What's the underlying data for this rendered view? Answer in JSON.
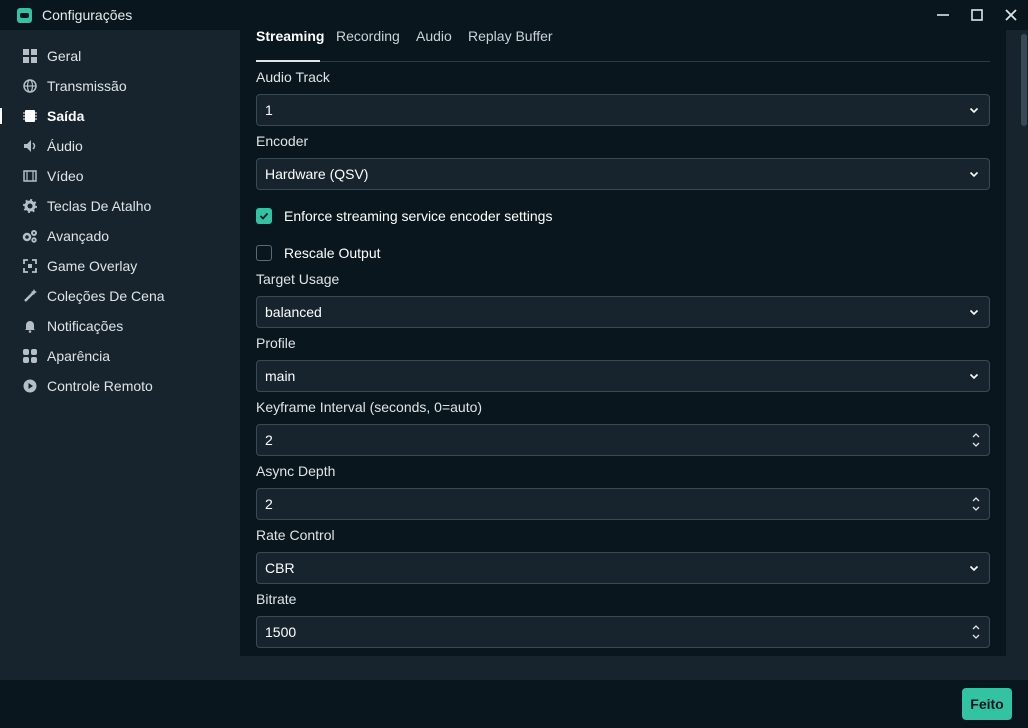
{
  "window": {
    "title": "Configurações"
  },
  "sidebar": {
    "items": [
      {
        "label": "Geral",
        "icon": "grid-icon"
      },
      {
        "label": "Transmissão",
        "icon": "globe-icon"
      },
      {
        "label": "Saída",
        "icon": "chip-icon",
        "active": true
      },
      {
        "label": "Áudio",
        "icon": "speaker-icon"
      },
      {
        "label": "Vídeo",
        "icon": "film-icon"
      },
      {
        "label": "Teclas De Atalho",
        "icon": "gear-icon"
      },
      {
        "label": "Avançado",
        "icon": "gears-icon"
      },
      {
        "label": "Game Overlay",
        "icon": "overlay-icon"
      },
      {
        "label": "Coleções De Cena",
        "icon": "wand-icon"
      },
      {
        "label": "Notificações",
        "icon": "bell-icon"
      },
      {
        "label": "Aparência",
        "icon": "palette-icon"
      },
      {
        "label": "Controle Remoto",
        "icon": "play-circle-icon"
      }
    ]
  },
  "tabs": [
    "Streaming",
    "Recording",
    "Audio",
    "Replay Buffer"
  ],
  "form": {
    "audio_track": {
      "label": "Audio Track",
      "value": "1"
    },
    "encoder": {
      "label": "Encoder",
      "value": "Hardware (QSV)"
    },
    "enforce": {
      "label": "Enforce streaming service encoder settings",
      "checked": true
    },
    "rescale": {
      "label": "Rescale Output",
      "checked": false
    },
    "target_usage": {
      "label": "Target Usage",
      "value": "balanced"
    },
    "profile": {
      "label": "Profile",
      "value": "main"
    },
    "keyframe": {
      "label": "Keyframe Interval (seconds, 0=auto)",
      "value": "2"
    },
    "async_depth": {
      "label": "Async Depth",
      "value": "2"
    },
    "rate_control": {
      "label": "Rate Control",
      "value": "CBR"
    },
    "bitrate": {
      "label": "Bitrate",
      "value": "1500"
    }
  },
  "footer": {
    "done_label": "Feito"
  },
  "colors": {
    "accent": "#31c3a2",
    "panel": "#09161d",
    "background": "#17242d"
  }
}
